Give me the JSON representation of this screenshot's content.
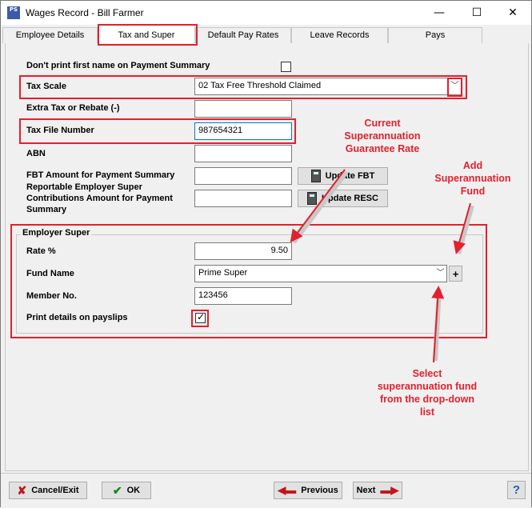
{
  "window": {
    "title": "Wages Record - Bill Farmer",
    "app_icon": "PS",
    "minimize": "—",
    "maximize": "☐",
    "close": "✕"
  },
  "tabs": [
    {
      "label": "Employee Details"
    },
    {
      "label": "Tax and Super"
    },
    {
      "label": "Default Pay Rates"
    },
    {
      "label": "Leave Records"
    },
    {
      "label": "Pays"
    }
  ],
  "form": {
    "dont_print_first_name_label": "Don't print first name on Payment Summary",
    "tax_scale_label": "Tax Scale",
    "tax_scale_value": "02 Tax Free Threshold Claimed",
    "extra_tax_label": "Extra Tax or Rebate (-)",
    "extra_tax_value": "",
    "tfn_label": "Tax File Number",
    "tfn_value": "987654321",
    "abn_label": "ABN",
    "abn_value": "",
    "fbt_label": "FBT Amount for Payment Summary",
    "fbt_value": "",
    "resc_label_1": "Reportable Employer Super",
    "resc_label_2": "Contributions Amount for Payment",
    "resc_label_3": "Summary",
    "resc_value": "",
    "update_fbt": "Update FBT",
    "update_resc": "Update RESC"
  },
  "employer_super": {
    "group_title": "Employer Super",
    "rate_label": "Rate %",
    "rate_value": "9.50",
    "fund_label": "Fund Name",
    "fund_value": "Prime Super",
    "add_fund": "+",
    "member_label": "Member No.",
    "member_value": "123456",
    "print_label": "Print details on payslips",
    "print_checked": true
  },
  "annotations": {
    "current_rate_1": "Current",
    "current_rate_2": "Superannuation",
    "current_rate_3": "Guarantee Rate",
    "add_fund_1": "Add",
    "add_fund_2": "Superannuation",
    "add_fund_3": "Fund",
    "select_1": "Select",
    "select_2": "superannuation fund",
    "select_3": "from the drop-down",
    "select_4": "list"
  },
  "buttons": {
    "cancel": "Cancel/Exit",
    "ok": "OK",
    "previous": "Previous",
    "next": "Next",
    "help": "?"
  },
  "colors": {
    "annotation_red": "#e3202d",
    "focus_blue": "#0078d7"
  }
}
